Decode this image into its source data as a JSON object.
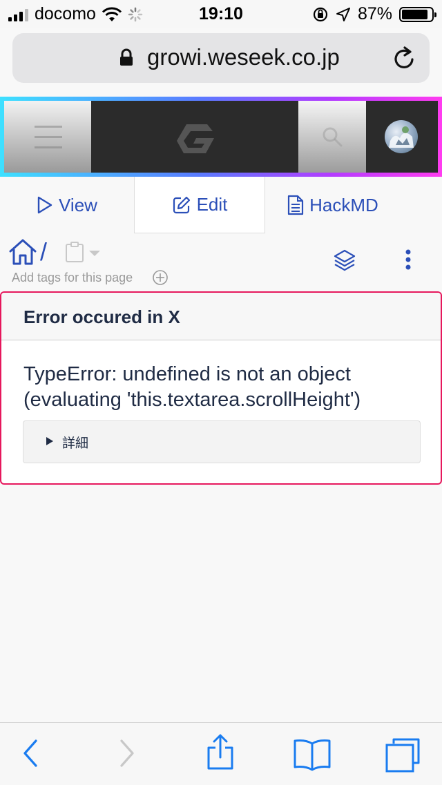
{
  "status_bar": {
    "carrier": "docomo",
    "time": "19:10",
    "battery_percent": "87%",
    "battery_level": 0.87
  },
  "browser": {
    "url": "growi.weseek.co.jp"
  },
  "tabs": [
    {
      "label": "View",
      "icon": "play-outline-icon"
    },
    {
      "label": "Edit",
      "icon": "pencil-square-icon"
    },
    {
      "label": "HackMD",
      "icon": "document-icon"
    }
  ],
  "breadcrumb": {
    "separator": "/"
  },
  "tags": {
    "placeholder": "Add tags for this page"
  },
  "error": {
    "title": "Error occured in X",
    "message": "TypeError: undefined is not an object (evaluating 'this.textarea.scrollHeight')",
    "details_label": "詳細"
  },
  "colors": {
    "accent": "#2b4fb8",
    "error_border": "#e6175c",
    "safari_blue": "#1a7cf0"
  }
}
